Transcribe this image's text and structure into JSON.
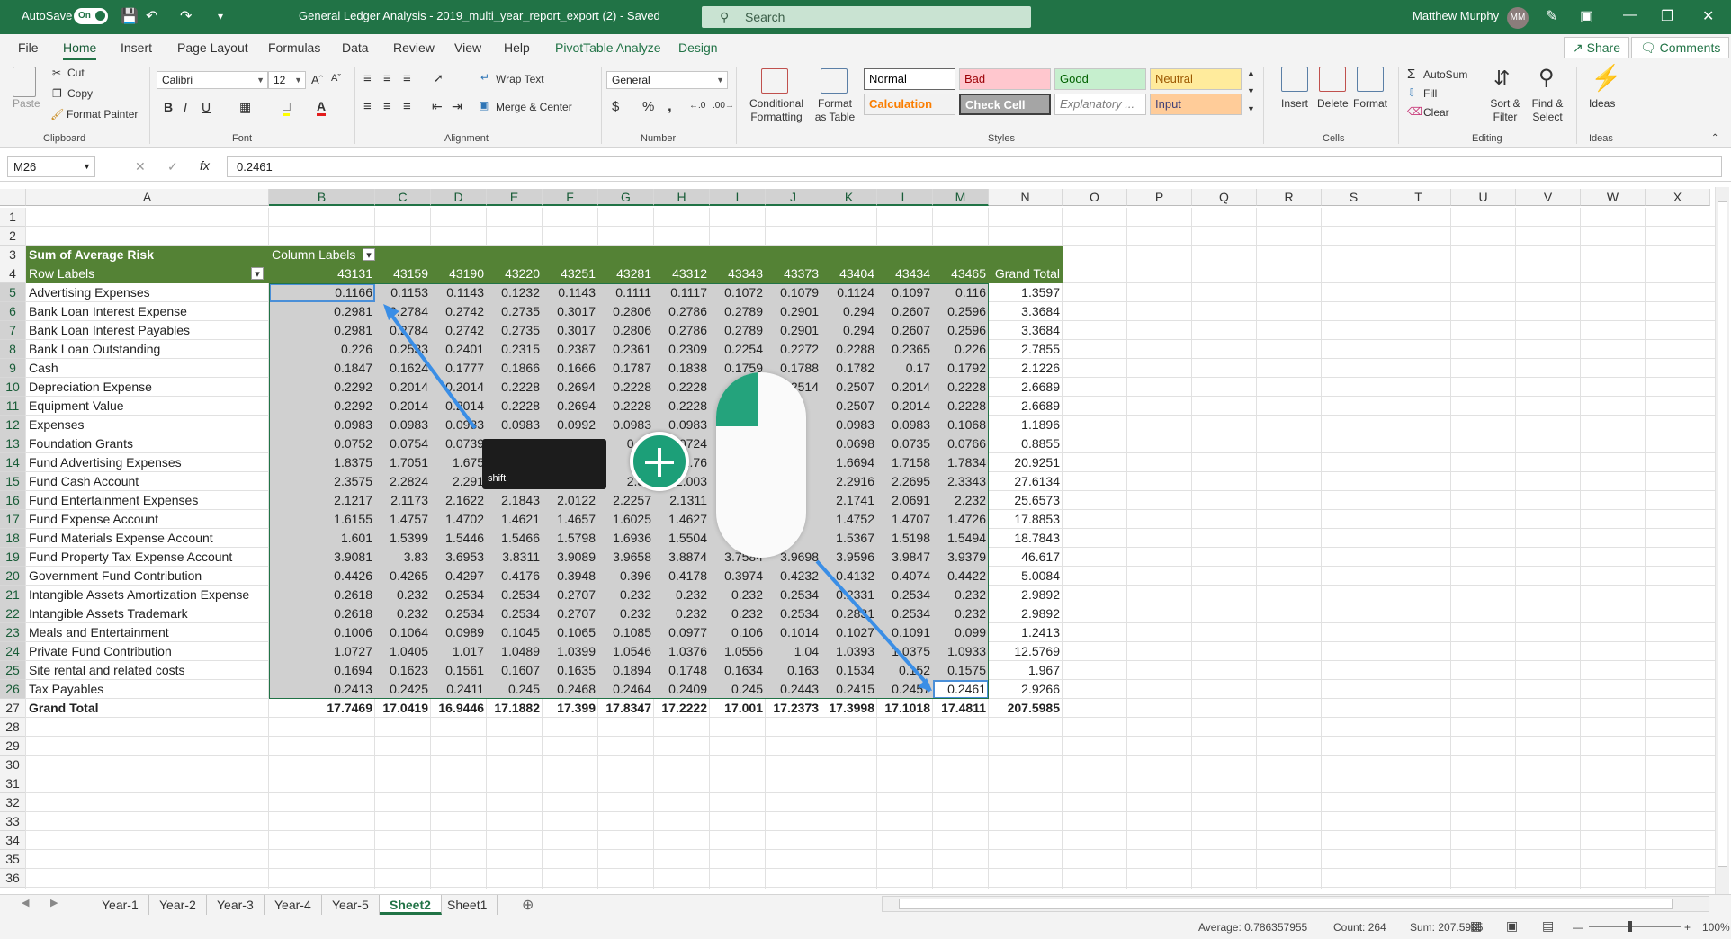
{
  "titlebar": {
    "autosave_label": "AutoSave",
    "autosave_state": "On",
    "doc_title": "General Ledger Analysis - 2019_multi_year_report_export (2)  -  Saved",
    "search_placeholder": "Search",
    "user_name": "Matthew Murphy",
    "user_initials": "MM"
  },
  "menu": {
    "tabs": [
      "File",
      "Home",
      "Insert",
      "Page Layout",
      "Formulas",
      "Data",
      "Review",
      "View",
      "Help",
      "PivotTable Analyze",
      "Design"
    ],
    "active_tab": "Home",
    "share": "Share",
    "comments": "Comments"
  },
  "ribbon": {
    "clipboard": {
      "paste": "Paste",
      "cut": "Cut",
      "copy": "Copy",
      "format_painter": "Format Painter",
      "label": "Clipboard"
    },
    "font": {
      "name": "Calibri",
      "size": "12",
      "bold": "B",
      "italic": "I",
      "underline": "U",
      "label": "Font"
    },
    "alignment": {
      "wrap": "Wrap Text",
      "merge": "Merge & Center",
      "label": "Alignment"
    },
    "number": {
      "format": "General",
      "currency": "$",
      "percent": "%",
      "comma": ",",
      "label": "Number"
    },
    "styles": {
      "conditional": "Conditional Formatting",
      "format_table": "Format as Table",
      "cells": [
        {
          "name": "Normal",
          "bg": "#ffffff",
          "fg": "#000000"
        },
        {
          "name": "Bad",
          "bg": "#ffc7ce",
          "fg": "#9c0006"
        },
        {
          "name": "Good",
          "bg": "#c6efce",
          "fg": "#006100"
        },
        {
          "name": "Neutral",
          "bg": "#ffeb9c",
          "fg": "#9c5700"
        },
        {
          "name": "Calculation",
          "bg": "#f2f2f2",
          "fg": "#fa7d00"
        },
        {
          "name": "Check Cell",
          "bg": "#a5a5a5",
          "fg": "#ffffff"
        },
        {
          "name": "Explanatory ...",
          "bg": "#ffffff",
          "fg": "#7f7f7f"
        },
        {
          "name": "Input",
          "bg": "#ffcc99",
          "fg": "#3f3f76"
        }
      ],
      "label": "Styles"
    },
    "cells": {
      "insert": "Insert",
      "delete": "Delete",
      "format": "Format",
      "label": "Cells"
    },
    "editing": {
      "autosum": "AutoSum",
      "fill": "Fill",
      "clear": "Clear",
      "sort": "Sort & Filter",
      "find": "Find & Select",
      "label": "Editing"
    },
    "ideas": {
      "ideas": "Ideas",
      "label": "Ideas"
    }
  },
  "formula_bar": {
    "name_box": "M26",
    "fx": "fx",
    "formula": "0.2461"
  },
  "columns": [
    "A",
    "B",
    "C",
    "D",
    "E",
    "F",
    "G",
    "H",
    "I",
    "J",
    "K",
    "L",
    "M",
    "N",
    "O",
    "P",
    "Q",
    "R",
    "S",
    "T",
    "U",
    "V",
    "W",
    "X"
  ],
  "pivot": {
    "title": "Sum of Average Risk",
    "col_labels": "Column Labels",
    "row_labels": "Row Labels",
    "dates": [
      "43131",
      "43159",
      "43190",
      "43220",
      "43251",
      "43281",
      "43312",
      "43343",
      "43373",
      "43404",
      "43434",
      "43465"
    ],
    "grand_total_label": "Grand Total",
    "rows": [
      {
        "label": "Advertising Expenses",
        "values": [
          "0.1166",
          "0.1153",
          "0.1143",
          "0.1232",
          "0.1143",
          "0.1111",
          "0.1117",
          "0.1072",
          "0.1079",
          "0.1124",
          "0.1097",
          "0.116"
        ],
        "total": "1.3597"
      },
      {
        "label": "Bank Loan Interest Expense",
        "values": [
          "0.2981",
          "0.2784",
          "0.2742",
          "0.2735",
          "0.3017",
          "0.2806",
          "0.2786",
          "0.2789",
          "0.2901",
          "0.294",
          "0.2607",
          "0.2596"
        ],
        "total": "3.3684"
      },
      {
        "label": "Bank Loan Interest Payables",
        "values": [
          "0.2981",
          "0.2784",
          "0.2742",
          "0.2735",
          "0.3017",
          "0.2806",
          "0.2786",
          "0.2789",
          "0.2901",
          "0.294",
          "0.2607",
          "0.2596"
        ],
        "total": "3.3684"
      },
      {
        "label": "Bank Loan Outstanding",
        "values": [
          "0.226",
          "0.2533",
          "0.2401",
          "0.2315",
          "0.2387",
          "0.2361",
          "0.2309",
          "0.2254",
          "0.2272",
          "0.2288",
          "0.2365",
          "0.226"
        ],
        "total": "2.7855"
      },
      {
        "label": "Cash",
        "values": [
          "0.1847",
          "0.1624",
          "0.1777",
          "0.1866",
          "0.1666",
          "0.1787",
          "0.1838",
          "0.1759",
          "0.1788",
          "0.1782",
          "0.17",
          "0.1792"
        ],
        "total": "2.1226"
      },
      {
        "label": "Depreciation Expense",
        "values": [
          "0.2292",
          "0.2014",
          "0.2014",
          "0.2228",
          "0.2694",
          "0.2228",
          "0.2228",
          "",
          "0.2514",
          "0.2507",
          "0.2014",
          "0.2228"
        ],
        "total": "2.6689"
      },
      {
        "label": "Equipment Value",
        "values": [
          "0.2292",
          "0.2014",
          "0.2014",
          "0.2228",
          "0.2694",
          "0.2228",
          "0.2228",
          "",
          "",
          "0.2507",
          "0.2014",
          "0.2228"
        ],
        "total": "2.6689"
      },
      {
        "label": "Expenses",
        "values": [
          "0.0983",
          "0.0983",
          "0.0983",
          "0.0983",
          "0.0992",
          "0.0983",
          "0.0983",
          "",
          "",
          "0.0983",
          "0.0983",
          "0.1068"
        ],
        "total": "1.1896"
      },
      {
        "label": "Foundation Grants",
        "values": [
          "0.0752",
          "0.0754",
          "0.0739",
          "",
          "",
          "0.07",
          "0.0724",
          "",
          "",
          "0.0698",
          "0.0735",
          "0.0766"
        ],
        "total": "0.8855"
      },
      {
        "label": "Fund Advertising Expenses",
        "values": [
          "1.8375",
          "1.7051",
          "1.675",
          "",
          "",
          "",
          "1.76",
          "",
          "",
          "1.6694",
          "1.7158",
          "1.7834"
        ],
        "total": "20.9251"
      },
      {
        "label": "Fund Cash Account",
        "values": [
          "2.3575",
          "2.2824",
          "2.291",
          "",
          "",
          "2.31",
          "2.003",
          "",
          "",
          "2.2916",
          "2.2695",
          "2.3343"
        ],
        "total": "27.6134"
      },
      {
        "label": "Fund Entertainment Expenses",
        "values": [
          "2.1217",
          "2.1173",
          "2.1622",
          "2.1843",
          "2.0122",
          "2.2257",
          "2.1311",
          "",
          "",
          "2.1741",
          "2.0691",
          "2.232"
        ],
        "total": "25.6573"
      },
      {
        "label": "Fund Expense Account",
        "values": [
          "1.6155",
          "1.4757",
          "1.4702",
          "1.4621",
          "1.4657",
          "1.6025",
          "1.4627",
          "",
          "",
          "1.4752",
          "1.4707",
          "1.4726"
        ],
        "total": "17.8853"
      },
      {
        "label": "Fund Materials Expense Account",
        "values": [
          "1.601",
          "1.5399",
          "1.5446",
          "1.5466",
          "1.5798",
          "1.6936",
          "1.5504",
          "",
          "",
          "1.5367",
          "1.5198",
          "1.5494"
        ],
        "total": "18.7843"
      },
      {
        "label": "Fund Property Tax Expense Account",
        "values": [
          "3.9081",
          "3.83",
          "3.6953",
          "3.8311",
          "3.9089",
          "3.9658",
          "3.8874",
          "3.7584",
          "3.9698",
          "3.9596",
          "3.9847",
          "3.9379"
        ],
        "total": "46.617"
      },
      {
        "label": "Government Fund Contribution",
        "values": [
          "0.4426",
          "0.4265",
          "0.4297",
          "0.4176",
          "0.3948",
          "0.396",
          "0.4178",
          "0.3974",
          "0.4232",
          "0.4132",
          "0.4074",
          "0.4422"
        ],
        "total": "5.0084"
      },
      {
        "label": "Intangible Assets Amortization Expense",
        "values": [
          "0.2618",
          "0.232",
          "0.2534",
          "0.2534",
          "0.2707",
          "0.232",
          "0.232",
          "0.232",
          "0.2534",
          "0.2331",
          "0.2534",
          "0.232"
        ],
        "total": "2.9892"
      },
      {
        "label": "Intangible Assets Trademark",
        "values": [
          "0.2618",
          "0.232",
          "0.2534",
          "0.2534",
          "0.2707",
          "0.232",
          "0.232",
          "0.232",
          "0.2534",
          "0.2831",
          "0.2534",
          "0.232"
        ],
        "total": "2.9892"
      },
      {
        "label": "Meals and Entertainment",
        "values": [
          "0.1006",
          "0.1064",
          "0.0989",
          "0.1045",
          "0.1065",
          "0.1085",
          "0.0977",
          "0.106",
          "0.1014",
          "0.1027",
          "0.1091",
          "0.099"
        ],
        "total": "1.2413"
      },
      {
        "label": "Private Fund Contribution",
        "values": [
          "1.0727",
          "1.0405",
          "1.017",
          "1.0489",
          "1.0399",
          "1.0546",
          "1.0376",
          "1.0556",
          "1.04",
          "1.0393",
          "1.0375",
          "1.0933"
        ],
        "total": "12.5769"
      },
      {
        "label": "Site rental and related costs",
        "values": [
          "0.1694",
          "0.1623",
          "0.1561",
          "0.1607",
          "0.1635",
          "0.1894",
          "0.1748",
          "0.1634",
          "0.163",
          "0.1534",
          "0.152",
          "0.1575"
        ],
        "total": "1.967"
      },
      {
        "label": "Tax Payables",
        "values": [
          "0.2413",
          "0.2425",
          "0.2411",
          "0.245",
          "0.2468",
          "0.2464",
          "0.2409",
          "0.245",
          "0.2443",
          "0.2415",
          "0.2457",
          "0.2461"
        ],
        "total": "2.9266"
      }
    ],
    "grand": {
      "label": "Grand Total",
      "values": [
        "17.7469",
        "17.0419",
        "16.9446",
        "17.1882",
        "17.399",
        "17.8347",
        "17.2222",
        "17.001",
        "17.2373",
        "17.3998",
        "17.1018",
        "17.4811"
      ],
      "total": "207.5985"
    }
  },
  "overlay": {
    "key_label": "shift"
  },
  "sheets": [
    "Year-1",
    "Year-2",
    "Year-3",
    "Year-4",
    "Year-5",
    "Sheet2",
    "Sheet1"
  ],
  "active_sheet": "Sheet2",
  "status": {
    "average": "Average: 0.786357955",
    "count": "Count: 264",
    "sum": "Sum: 207.5985",
    "zoom": "100%"
  }
}
